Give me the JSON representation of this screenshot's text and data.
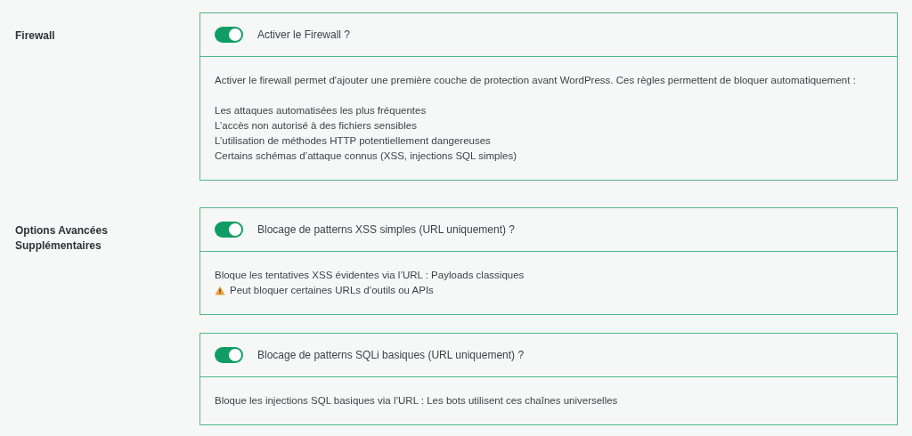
{
  "sections": [
    {
      "label": "Firewall",
      "options": [
        {
          "title": "Activer le Firewall ?",
          "on": true,
          "paragraphs": [
            [
              {
                "kind": "text",
                "text": "Activer le firewall permet d'ajouter une première couche de protection avant WordPress. Ces règles permettent de bloquer automatiquement :"
              }
            ],
            [
              {
                "kind": "text",
                "text": "Les attaques automatisées les plus fréquentes"
              },
              {
                "kind": "text",
                "text": "L’accès non autorisé à des fichiers sensibles"
              },
              {
                "kind": "text",
                "text": "L’utilisation de méthodes HTTP potentiellement dangereuses"
              },
              {
                "kind": "text",
                "text": "Certains schémas d’attaque connus (XSS, injections SQL simples)"
              }
            ]
          ]
        }
      ]
    },
    {
      "label": "Options Avancées Supplémentaires",
      "options": [
        {
          "title": "Blocage de patterns XSS simples (URL uniquement) ?",
          "on": true,
          "paragraphs": [
            [
              {
                "kind": "text",
                "text": "Bloque les tentatives XSS évidentes via l’URL : Payloads classiques"
              },
              {
                "kind": "warning",
                "text": "Peut bloquer certaines URLs d’outils ou APIs"
              }
            ]
          ]
        },
        {
          "title": "Blocage de patterns SQLi basiques (URL uniquement) ?",
          "on": true,
          "paragraphs": [
            [
              {
                "kind": "text",
                "text": "Bloque les injections SQL basiques via l’URL : Les bots utilisent ces chaînes universelles"
              }
            ]
          ]
        }
      ]
    }
  ]
}
